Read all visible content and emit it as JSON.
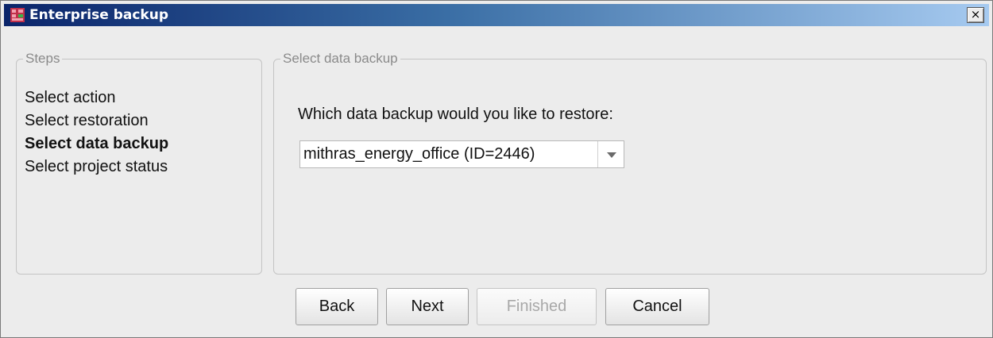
{
  "window": {
    "title": "Enterprise backup",
    "close_glyph": "×"
  },
  "steps": {
    "legend": "Steps",
    "items": [
      {
        "label": "Select action",
        "active": false
      },
      {
        "label": "Select restoration",
        "active": false
      },
      {
        "label": "Select data backup",
        "active": true
      },
      {
        "label": "Select project status",
        "active": false
      }
    ]
  },
  "backup": {
    "legend": "Select data backup",
    "question": "Which data backup would you like to restore:",
    "selected": "mithras_energy_office (ID=2446)"
  },
  "buttons": {
    "back": "Back",
    "next": "Next",
    "finished": "Finished",
    "cancel": "Cancel"
  },
  "colors": {
    "title_gradient_start": "#0a246a",
    "title_gradient_end": "#a6caf0",
    "app_icon": "#c0304a"
  }
}
